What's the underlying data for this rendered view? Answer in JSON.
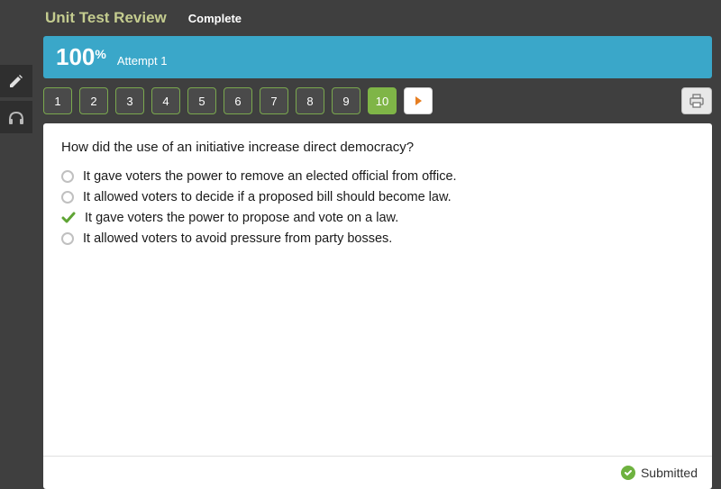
{
  "header": {
    "title": "Unit Test Review",
    "status": "Complete"
  },
  "score": {
    "value": "100",
    "percent": "%",
    "attempt": "Attempt 1"
  },
  "nav": {
    "items": [
      "1",
      "2",
      "3",
      "4",
      "5",
      "6",
      "7",
      "8",
      "9",
      "10"
    ],
    "active": 9
  },
  "question": {
    "text": "How did the use of an initiative increase direct democracy?",
    "options": [
      {
        "text": "It gave voters the power to remove an elected official from office.",
        "correct": false
      },
      {
        "text": "It allowed voters to decide if a proposed bill should become law.",
        "correct": false
      },
      {
        "text": "It gave voters the power to propose and vote on a law.",
        "correct": true
      },
      {
        "text": "It allowed voters to avoid pressure from party bosses.",
        "correct": false
      }
    ]
  },
  "footer": {
    "status": "Submitted"
  }
}
